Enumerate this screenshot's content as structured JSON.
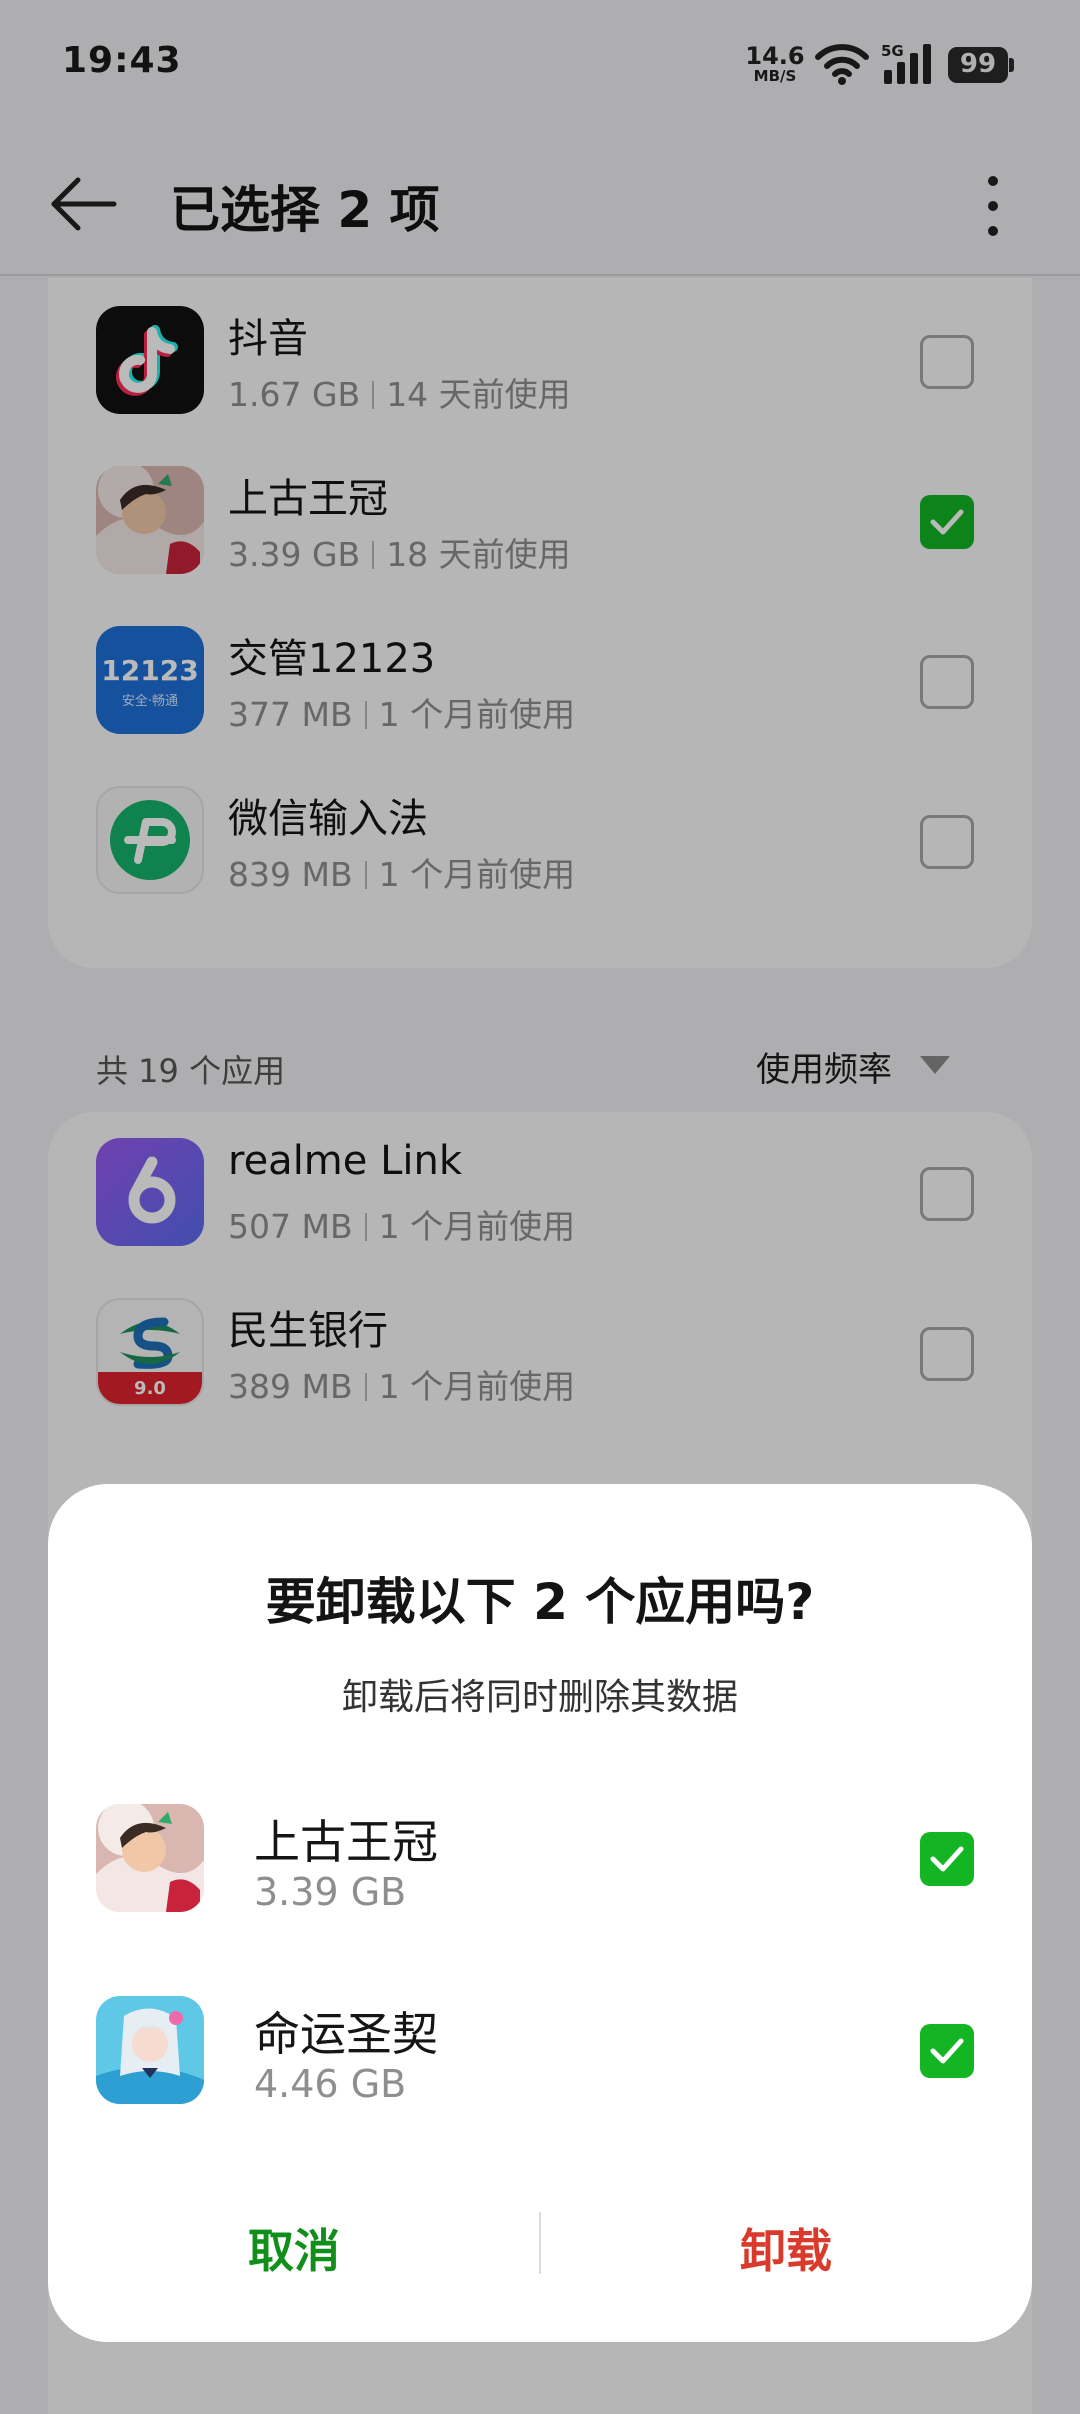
{
  "status_bar": {
    "time": "19:43",
    "net_speed_value": "14.6",
    "net_speed_unit": "MB/S",
    "network_type": "5G",
    "battery_level": "99"
  },
  "app_bar": {
    "title": "已选择 2 项"
  },
  "recent_list": [
    {
      "name": "抖音",
      "size": "1.67 GB",
      "last_used": "14 天前使用",
      "icon": "douyin-icon",
      "checked": false
    },
    {
      "name": "上古王冠",
      "size": "3.39 GB",
      "last_used": "18 天前使用",
      "icon": "ancient-crown-game-icon",
      "checked": true
    },
    {
      "name": "交管12123",
      "size": "377 MB",
      "last_used": "1 个月前使用",
      "icon": "traffic-12123-icon",
      "checked": false,
      "icon_text": "12123",
      "icon_subtext": "安全·畅通"
    },
    {
      "name": "微信输入法",
      "size": "839 MB",
      "last_used": "1 个月前使用",
      "icon": "wechat-input-icon",
      "checked": false
    }
  ],
  "all_apps": {
    "count_label": "共 19 个应用",
    "sort_label": "使用频率",
    "items": [
      {
        "name": "realme Link",
        "size": "507 MB",
        "last_used": "1 个月前使用",
        "icon": "realme-link-icon",
        "checked": false
      },
      {
        "name": "民生银行",
        "size": "389 MB",
        "last_used": "1 个月前使用",
        "icon": "minsheng-bank-icon",
        "checked": false,
        "icon_text": "9.0"
      }
    ]
  },
  "dialog": {
    "title": "要卸载以下 2 个应用吗?",
    "subtitle": "卸载后将同时删除其数据",
    "apps": [
      {
        "name": "上古王冠",
        "size": "3.39 GB",
        "icon": "ancient-crown-game-icon",
        "checked": true
      },
      {
        "name": "命运圣契",
        "size": "4.46 GB",
        "icon": "fate-covenant-game-icon",
        "checked": true
      }
    ],
    "cancel_label": "取消",
    "confirm_label": "卸载"
  },
  "colors": {
    "check_green": "#13b523",
    "cancel_green": "#128f1b",
    "confirm_red": "#d93a2b",
    "page_bg": "#efeff1"
  }
}
